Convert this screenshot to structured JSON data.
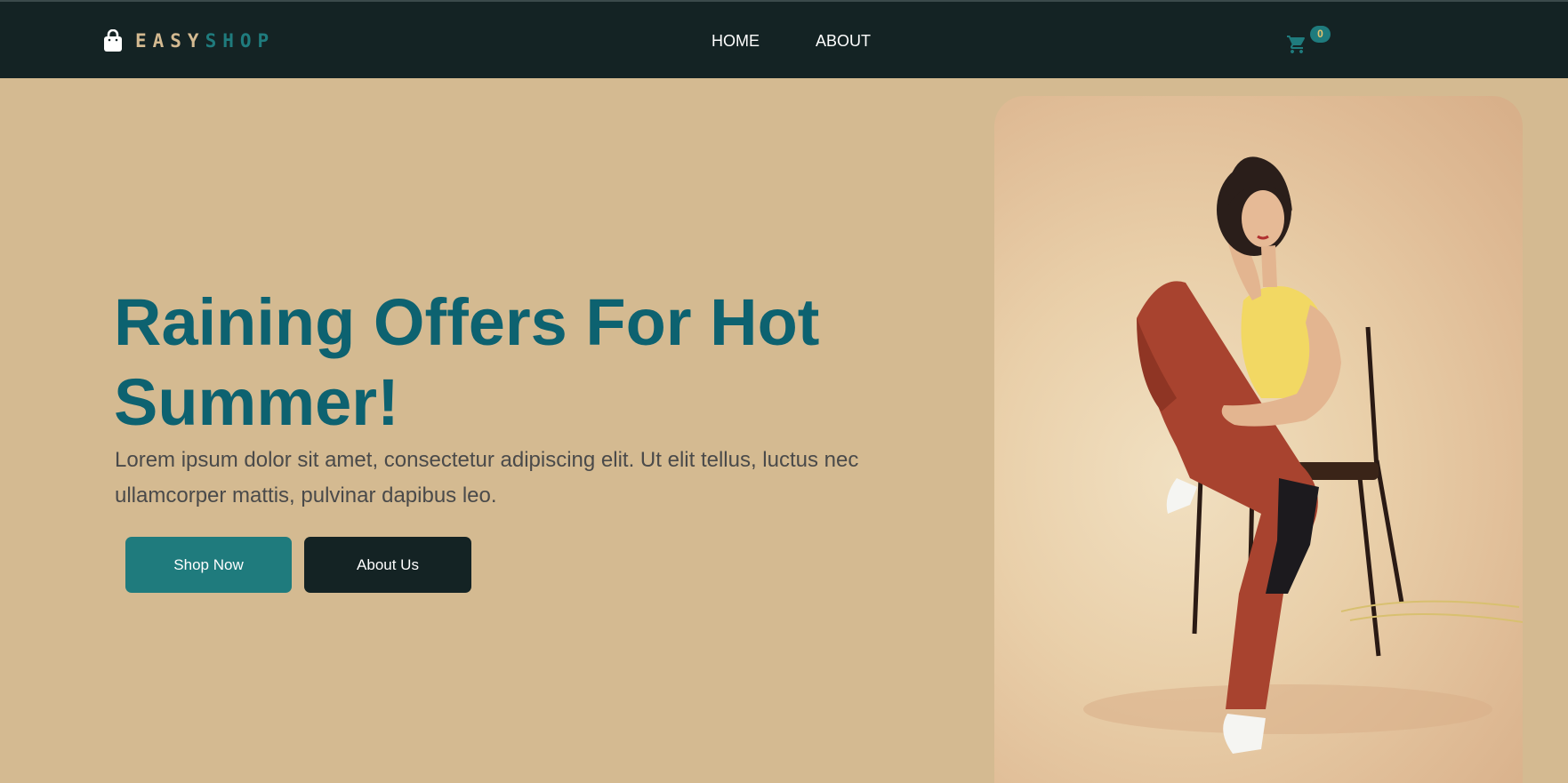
{
  "brand": {
    "part1": "EASY",
    "part2": "SHOP",
    "icon": "shopping-bag-icon"
  },
  "nav": {
    "links": [
      "HOME",
      "ABOUT"
    ]
  },
  "cart": {
    "icon": "cart-icon",
    "count": "0"
  },
  "hero": {
    "title": "Raining Offers For Hot Summer!",
    "text": "Lorem ipsum dolor sit amet, consectetur adipiscing elit. Ut elit tellus, luctus nec ullamcorper mattis, pulvinar dapibus leo.",
    "buttons": {
      "primary": "Shop Now",
      "secondary": "About Us"
    },
    "image": "fashion-model-photo"
  },
  "colors": {
    "navbar_bg": "#142324",
    "page_bg": "#d4ba91",
    "accent_teal": "#1f7b7d",
    "title_teal": "#0d6270",
    "dark_button": "#142324"
  }
}
